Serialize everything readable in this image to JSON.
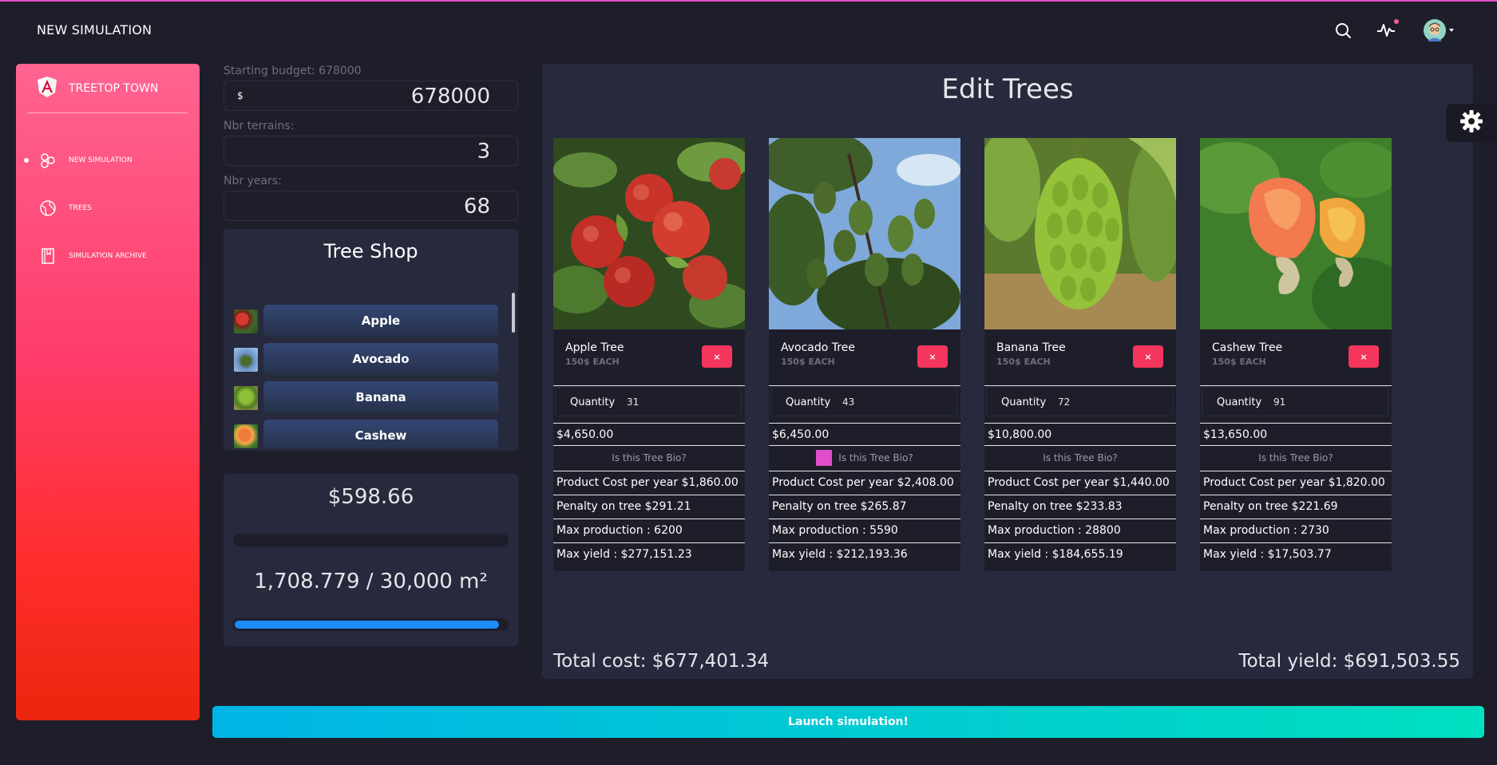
{
  "navbar": {
    "title": "NEW SIMULATION",
    "icons": [
      "search-icon",
      "activity-icon",
      "avatar"
    ],
    "notification_color": "#fd5d93"
  },
  "sidebar": {
    "brand": "TREETOP TOWN",
    "items": [
      {
        "label": "NEW SIMULATION",
        "icon": "atom-icon",
        "active": true
      },
      {
        "label": "TREES",
        "icon": "planet-icon",
        "active": false
      },
      {
        "label": "SIMULATION ARCHIVE",
        "icon": "book-icon",
        "active": false
      }
    ]
  },
  "budget": {
    "label": "Starting budget: 678000",
    "prefix": "$",
    "value": "678000"
  },
  "terrains": {
    "label": "Nbr terrains:",
    "value": "3"
  },
  "years": {
    "label": "Nbr years:",
    "value": "68"
  },
  "shop": {
    "title": "Tree Shop",
    "items": [
      "Apple",
      "Avocado",
      "Banana",
      "Cashew"
    ]
  },
  "summary": {
    "money": "$598.66",
    "money_fraction": 0.0,
    "area": "1,708.779 / 30,000 m²",
    "area_fraction": 0.97
  },
  "edit": {
    "title": "Edit Trees",
    "trees": [
      {
        "name": "Apple Tree",
        "price": "150$ EACH",
        "remove": "×",
        "qty_label": "Quantity",
        "qty": "31",
        "cost": "$4,650.00",
        "bio_label": "Is this Tree Bio?",
        "bio": false,
        "product_cost": "Product Cost per year $1,860.00",
        "penalty": "Penalty on tree $291.21",
        "max_production": "Max production : 6200",
        "max_yield": "Max yield : $277,151.23"
      },
      {
        "name": "Avocado Tree",
        "price": "150$ EACH",
        "remove": "×",
        "qty_label": "Quantity",
        "qty": "43",
        "cost": "$6,450.00",
        "bio_label": "Is this Tree Bio?",
        "bio": true,
        "product_cost": "Product Cost per year $2,408.00",
        "penalty": "Penalty on tree $265.87",
        "max_production": "Max production : 5590",
        "max_yield": "Max yield : $212,193.36"
      },
      {
        "name": "Banana Tree",
        "price": "150$ EACH",
        "remove": "×",
        "qty_label": "Quantity",
        "qty": "72",
        "cost": "$10,800.00",
        "bio_label": "Is this Tree Bio?",
        "bio": false,
        "product_cost": "Product Cost per year $1,440.00",
        "penalty": "Penalty on tree $233.83",
        "max_production": "Max production : 28800",
        "max_yield": "Max yield : $184,655.19"
      },
      {
        "name": "Cashew Tree",
        "price": "150$ EACH",
        "remove": "×",
        "qty_label": "Quantity",
        "qty": "91",
        "cost": "$13,650.00",
        "bio_label": "Is this Tree Bio?",
        "bio": false,
        "product_cost": "Product Cost per year $1,820.00",
        "penalty": "Penalty on tree $221.69",
        "max_production": "Max production : 2730",
        "max_yield": "Max yield : $17,503.77"
      }
    ],
    "total_cost": "Total cost: $677,401.34",
    "total_yield": "Total yield: $691,503.55"
  },
  "launch_label": "Launch simulation!",
  "colors": {
    "accent": "#e14eca",
    "danger": "#f5365c",
    "primary": "#1d8cf8",
    "background": "#1e1e2b",
    "panel": "#27293d"
  }
}
